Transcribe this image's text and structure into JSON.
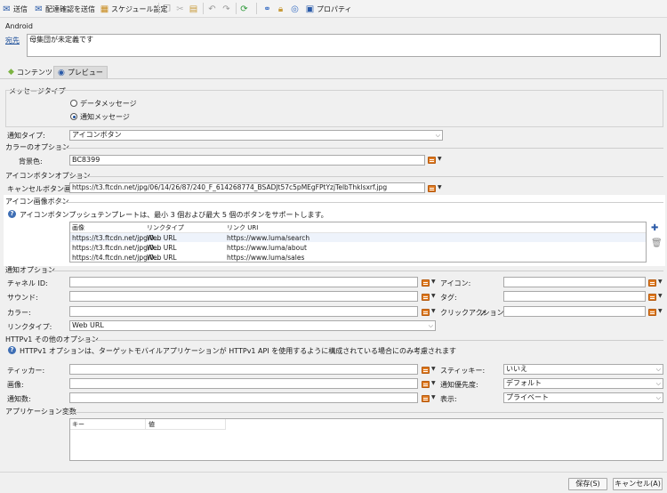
{
  "toolbar": {
    "send": "送信",
    "send_proof": "配達確認を送信",
    "schedule": "スケジュール設定",
    "properties": "プロパティ"
  },
  "header": {
    "channel": "Android",
    "target_link": "宛先",
    "target_value": "母集団が未定義です"
  },
  "tabs": [
    {
      "label": "コンテンツ"
    },
    {
      "label": "プレビュー"
    }
  ],
  "message_type": {
    "title": "メッセージタイプ",
    "option_data": "データメッセージ",
    "option_notification": "通知メッセージ",
    "selected": "通知メッセージ"
  },
  "notification_type": {
    "label": "通知タイプ:",
    "value": "アイコンボタン"
  },
  "color_options": {
    "title": "カラーのオプション",
    "background_label": "背景色:",
    "background_value": "BC8399"
  },
  "icon_button_options": {
    "title": "アイコンボタンオプション",
    "cancel_label": "キャンセルボタン画像:",
    "cancel_value": "https://t3.ftcdn.net/jpg/06/14/26/87/240_F_614268774_BSADJt57c5pMEgFPtYzjTelbThklsxrf.jpg"
  },
  "icon_image_buttons": {
    "title": "アイコン画像ボタン",
    "info": "アイコンボタンプッシュテンプレートは、最小 3 個および最大 5 個のボタンをサポートします。",
    "columns": [
      "画像",
      "リンクタイプ",
      "リンク URI"
    ],
    "rows": [
      [
        "https://t3.ftcdn.net/jpg/0...",
        "Web URL",
        "https://www.luma/search"
      ],
      [
        "https://t3.ftcdn.net/jpg/0...",
        "Web URL",
        "https://www.luma/about"
      ],
      [
        "https://t4.ftcdn.net/jpg/0...",
        "Web URL",
        "https://www.luma/sales"
      ]
    ]
  },
  "notification_options": {
    "title": "通知オプション",
    "channel_id": "チャネル ID:",
    "sound": "サウンド:",
    "color": "カラー:",
    "link_type": "リンクタイプ:",
    "link_type_value": "Web URL",
    "icon": "アイコン:",
    "tag": "タグ:",
    "click_action": "クリックアクション:"
  },
  "httpv1_options": {
    "title": "HTTPv1 その他のオプション",
    "info": "HTTPv1 オプションは、ターゲットモバイルアプリケーションが HTTPv1 API を使用するように構成されている場合にのみ考慮されます",
    "ticker": "ティッカー:",
    "image": "画像:",
    "notification_count": "通知数:",
    "sticky": "スティッキー:",
    "sticky_value": "いいえ",
    "priority": "通知優先度:",
    "priority_value": "デフォルト",
    "visibility": "表示:",
    "visibility_value": "プライベート"
  },
  "app_variables": {
    "title": "アプリケーション変数",
    "columns": [
      "キー",
      "値"
    ]
  },
  "footer": {
    "save": "保存(S)",
    "cancel": "キャンセル(A)"
  },
  "colors": {
    "accent": "#1a4d99",
    "highlight_panel": "#ffffff"
  }
}
